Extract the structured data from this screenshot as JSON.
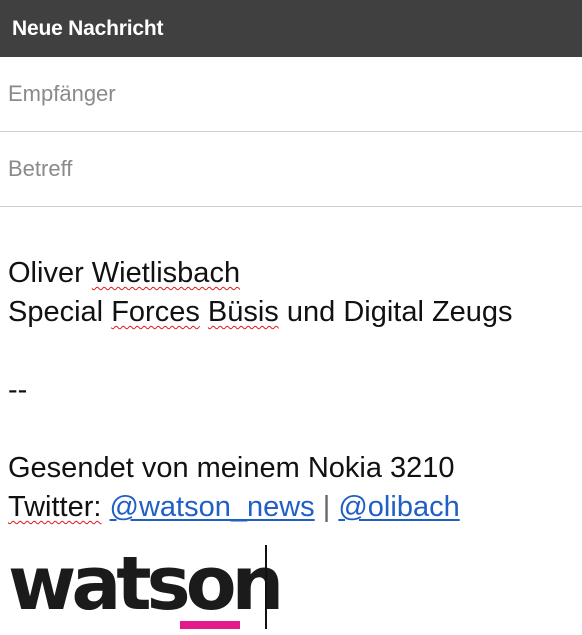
{
  "window": {
    "title": "Neue Nachricht"
  },
  "compose": {
    "recipient_placeholder": "Empfänger",
    "subject_placeholder": "Betreff"
  },
  "signature": {
    "name_first": "Oliver",
    "name_last": "Wietlisbach",
    "role_word1": "Special",
    "role_word2": "Forces",
    "role_word3": "Büsis",
    "role_rest": "und Digital Zeugs",
    "divider": "--",
    "sent_from": "Gesendet von meinem Nokia 3210",
    "twitter_label": "Twitter:",
    "twitter_link1": "@watson_news",
    "separator": "|",
    "twitter_link2": "@olibach",
    "logo_text": "watson"
  },
  "colors": {
    "titlebar": "#404040",
    "link": "#1f5fc6",
    "logo_accent": "#e4198c",
    "spellcheck": "#e01818"
  }
}
